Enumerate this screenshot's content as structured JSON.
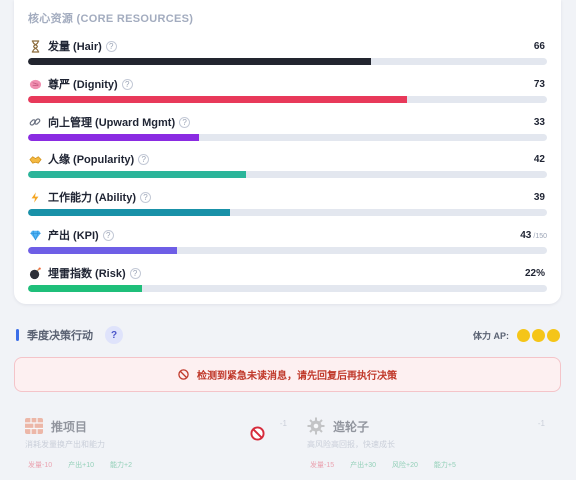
{
  "resources": {
    "title": "核心资源 (CORE RESOURCES)",
    "items": [
      {
        "name": "发量 (Hair)",
        "value": "66",
        "max": "",
        "fraction": 0.66,
        "color": "#22252f",
        "icon": "hourglass-icon"
      },
      {
        "name": "尊严 (Dignity)",
        "value": "73",
        "max": "",
        "fraction": 0.73,
        "color": "#e8395a",
        "icon": "brain-icon"
      },
      {
        "name": "向上管理 (Upward Mgmt)",
        "value": "33",
        "max": "",
        "fraction": 0.33,
        "color": "#8a2be2",
        "icon": "link-icon"
      },
      {
        "name": "人缘 (Popularity)",
        "value": "42",
        "max": "",
        "fraction": 0.42,
        "color": "#2bb59a",
        "icon": "handshake-icon"
      },
      {
        "name": "工作能力 (Ability)",
        "value": "39",
        "max": "",
        "fraction": 0.39,
        "color": "#1991a8",
        "icon": "lightning-icon"
      },
      {
        "name": "产出 (KPI)",
        "value": "43",
        "max": "/150",
        "fraction": 0.2867,
        "color": "#6e5ee6",
        "icon": "gem-icon"
      },
      {
        "name": "埋雷指数 (Risk)",
        "value": "22%",
        "max": "",
        "fraction": 0.22,
        "color": "#1fbf7a",
        "icon": "bomb-icon"
      }
    ],
    "help_glyph": "?"
  },
  "decisions": {
    "title": "季度决策行动",
    "help_glyph": "?",
    "ap_label": "体力 AP:",
    "ap_points": 3,
    "ap_color": "#f5c518"
  },
  "alert": {
    "text": "检测到紧急未读消息，请先回复后再执行决策"
  },
  "actions": [
    {
      "name": "推项目",
      "cost": "-1",
      "desc": "消耗发量换产出和能力",
      "icon": "brick-wall-icon",
      "effects": [
        {
          "label": "发量-10",
          "kind": "neg"
        },
        {
          "label": "产出+10",
          "kind": "pos"
        },
        {
          "label": "能力+2",
          "kind": "pos"
        }
      ]
    },
    {
      "name": "造轮子",
      "cost": "-1",
      "desc": "高风险高回报，快速成长",
      "icon": "gear-icon",
      "effects": [
        {
          "label": "发量-15",
          "kind": "neg"
        },
        {
          "label": "产出+30",
          "kind": "pos"
        },
        {
          "label": "风险+20",
          "kind": "pos"
        },
        {
          "label": "能力+5",
          "kind": "pos"
        }
      ]
    }
  ]
}
